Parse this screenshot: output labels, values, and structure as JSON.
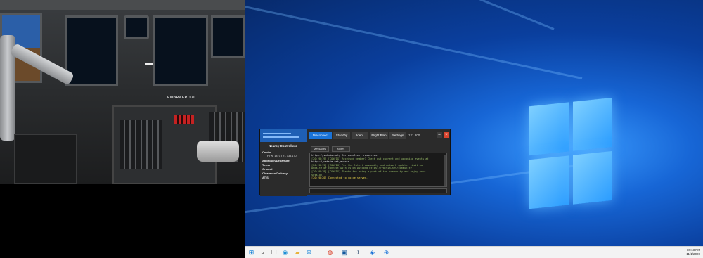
{
  "simulator": {
    "aircraft_label": "EMBRAER 170"
  },
  "client": {
    "toolbar": {
      "disconnect_label": "Disconnect",
      "standby_label": "Standby",
      "ident_label": "Ident",
      "flight_plan_label": "Flight Plan",
      "settings_label": "Settings",
      "frequency_label": "121.800",
      "minimize_label": "–",
      "close_label": "×"
    },
    "sidebar": {
      "title": "Nearby Controllers",
      "categories": [
        {
          "label": "Center"
        },
        {
          "label": "Approach/Departure"
        },
        {
          "label": "Tower"
        },
        {
          "label": "Ground"
        },
        {
          "label": "Clearance Delivery"
        },
        {
          "label": "ATIS"
        }
      ],
      "center_entry": "FTW_14_CTR - 135.170"
    },
    "tabs": [
      {
        "label": "Messages"
      },
      {
        "label": "Notes"
      }
    ],
    "log": [
      {
        "text": "https://vatsim.net/ for excellent resources.",
        "color": "#e8e8e8"
      },
      {
        "text": "[20:28:19] [CONFIG] Received member? Check out current and upcoming events at",
        "color": "#9bbf6a"
      },
      {
        "text": "https://vatsim.net/events",
        "color": "#e8e8e8"
      },
      {
        "text": "[20:28:19] [CONFIG] For the latest community and network updates visit our",
        "color": "#9bbf6a"
      },
      {
        "text": "website or connect with us on Discord https://vatsim.net/community",
        "color": "#9bbf6a"
      },
      {
        "text": "[20:28:19] [CONFIG] Thanks for being a part of the community and enjoy your",
        "color": "#9bbf6a"
      },
      {
        "text": "session!",
        "color": "#9bbf6a"
      },
      {
        "text": "[20:28:20] Connected to voice server.",
        "color": "#e8d24a"
      }
    ]
  },
  "taskbar": {
    "icons": [
      {
        "name": "start-icon",
        "glyph": "⊞",
        "color": "#0078d4"
      },
      {
        "name": "search-icon",
        "glyph": "⌕",
        "color": "#222"
      },
      {
        "name": "task-view-icon",
        "glyph": "❐",
        "color": "#222"
      },
      {
        "name": "edge-icon",
        "glyph": "◉",
        "color": "#1d8fd6"
      },
      {
        "name": "file-explorer-icon",
        "glyph": "▰",
        "color": "#e8b33c"
      },
      {
        "name": "mail-icon",
        "glyph": "✉",
        "color": "#0078d4"
      },
      {
        "name": "chrome-icon",
        "glyph": "◍",
        "color": "#d9442e"
      },
      {
        "name": "photos-icon",
        "glyph": "▣",
        "color": "#14599e"
      },
      {
        "name": "xplane-icon",
        "glyph": "✈",
        "color": "#5a6f8a"
      },
      {
        "name": "vpilot-icon",
        "glyph": "◈",
        "color": "#1a73d8"
      },
      {
        "name": "flight-tool-icon",
        "glyph": "⊕",
        "color": "#1a73d8"
      }
    ],
    "time": "10:13 PM",
    "date": "11/1/2020"
  },
  "colors": {
    "accent": "#1a73d8",
    "close_button": "#d9442e",
    "desktop_glow": "#3b9cff"
  }
}
